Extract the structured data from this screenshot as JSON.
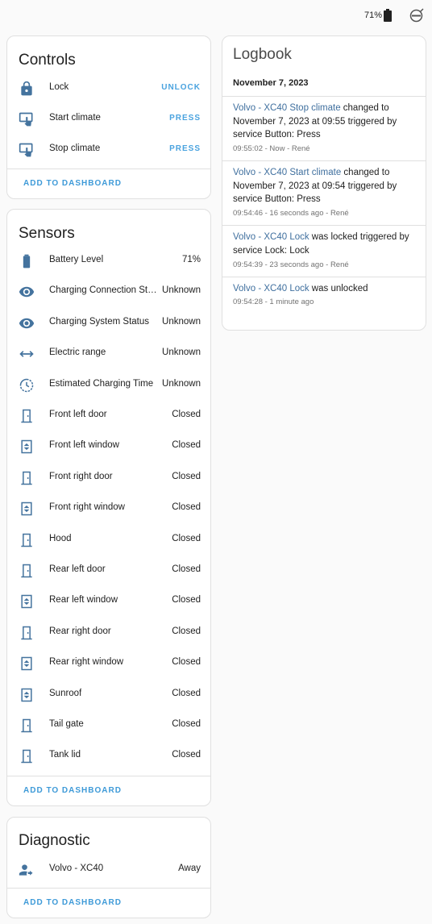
{
  "topbar": {
    "battery_text": "71%",
    "battery_icon": "battery-icon",
    "brand_icon": "volvo-logo-icon"
  },
  "controls": {
    "title": "Controls",
    "rows": [
      {
        "icon": "lock-icon",
        "label": "Lock",
        "action": "UNLOCK"
      },
      {
        "icon": "gesture-tap-button-icon",
        "label": "Start climate",
        "action": "PRESS"
      },
      {
        "icon": "gesture-tap-button-icon",
        "label": "Stop climate",
        "action": "PRESS"
      }
    ],
    "add_label": "ADD TO DASHBOARD"
  },
  "sensors": {
    "title": "Sensors",
    "rows": [
      {
        "icon": "battery-icon",
        "label": "Battery Level",
        "value": "71%"
      },
      {
        "icon": "eye-icon",
        "label": "Charging Connection Stat…",
        "value": "Unknown"
      },
      {
        "icon": "eye-icon",
        "label": "Charging System Status",
        "value": "Unknown"
      },
      {
        "icon": "arrow-left-right-icon",
        "label": "Electric range",
        "value": "Unknown"
      },
      {
        "icon": "clock-icon",
        "label": "Estimated Charging Time",
        "value": "Unknown"
      },
      {
        "icon": "door-icon",
        "label": "Front left door",
        "value": "Closed"
      },
      {
        "icon": "window-icon",
        "label": "Front left window",
        "value": "Closed"
      },
      {
        "icon": "door-icon",
        "label": "Front right door",
        "value": "Closed"
      },
      {
        "icon": "window-icon",
        "label": "Front right window",
        "value": "Closed"
      },
      {
        "icon": "door-icon",
        "label": "Hood",
        "value": "Closed"
      },
      {
        "icon": "door-icon",
        "label": "Rear left door",
        "value": "Closed"
      },
      {
        "icon": "window-icon",
        "label": "Rear left window",
        "value": "Closed"
      },
      {
        "icon": "door-icon",
        "label": "Rear right door",
        "value": "Closed"
      },
      {
        "icon": "window-icon",
        "label": "Rear right window",
        "value": "Closed"
      },
      {
        "icon": "window-icon",
        "label": "Sunroof",
        "value": "Closed"
      },
      {
        "icon": "door-icon",
        "label": "Tail gate",
        "value": "Closed"
      },
      {
        "icon": "door-icon",
        "label": "Tank lid",
        "value": "Closed"
      }
    ],
    "add_label": "ADD TO DASHBOARD"
  },
  "diagnostic": {
    "title": "Diagnostic",
    "rows": [
      {
        "icon": "account-arrow-right-icon",
        "label": "Volvo - XC40",
        "value": "Away"
      }
    ],
    "add_label": "ADD TO DASHBOARD"
  },
  "logbook": {
    "title": "Logbook",
    "date": "November 7, 2023",
    "entries": [
      {
        "entity": "Volvo - XC40 Stop climate",
        "text": " changed to November 7, 2023 at 09:55 triggered by service Button: Press",
        "meta": "09:55:02 - Now - René"
      },
      {
        "entity": "Volvo - XC40 Start climate",
        "text": " changed to November 7, 2023 at 09:54 triggered by service Button: Press",
        "meta": "09:54:46 - 16 seconds ago - René"
      },
      {
        "entity": "Volvo - XC40 Lock",
        "text": " was locked triggered by service Lock: Lock",
        "meta": "09:54:39 - 23 seconds ago - René"
      },
      {
        "entity": "Volvo - XC40 Lock",
        "text": " was unlocked",
        "meta": "09:54:28 - 1 minute ago"
      }
    ]
  },
  "colors": {
    "icon": "#44739e",
    "accent": "#4aa3df",
    "link": "#3f6f9e",
    "text": "#212121",
    "secondary": "#727272"
  }
}
